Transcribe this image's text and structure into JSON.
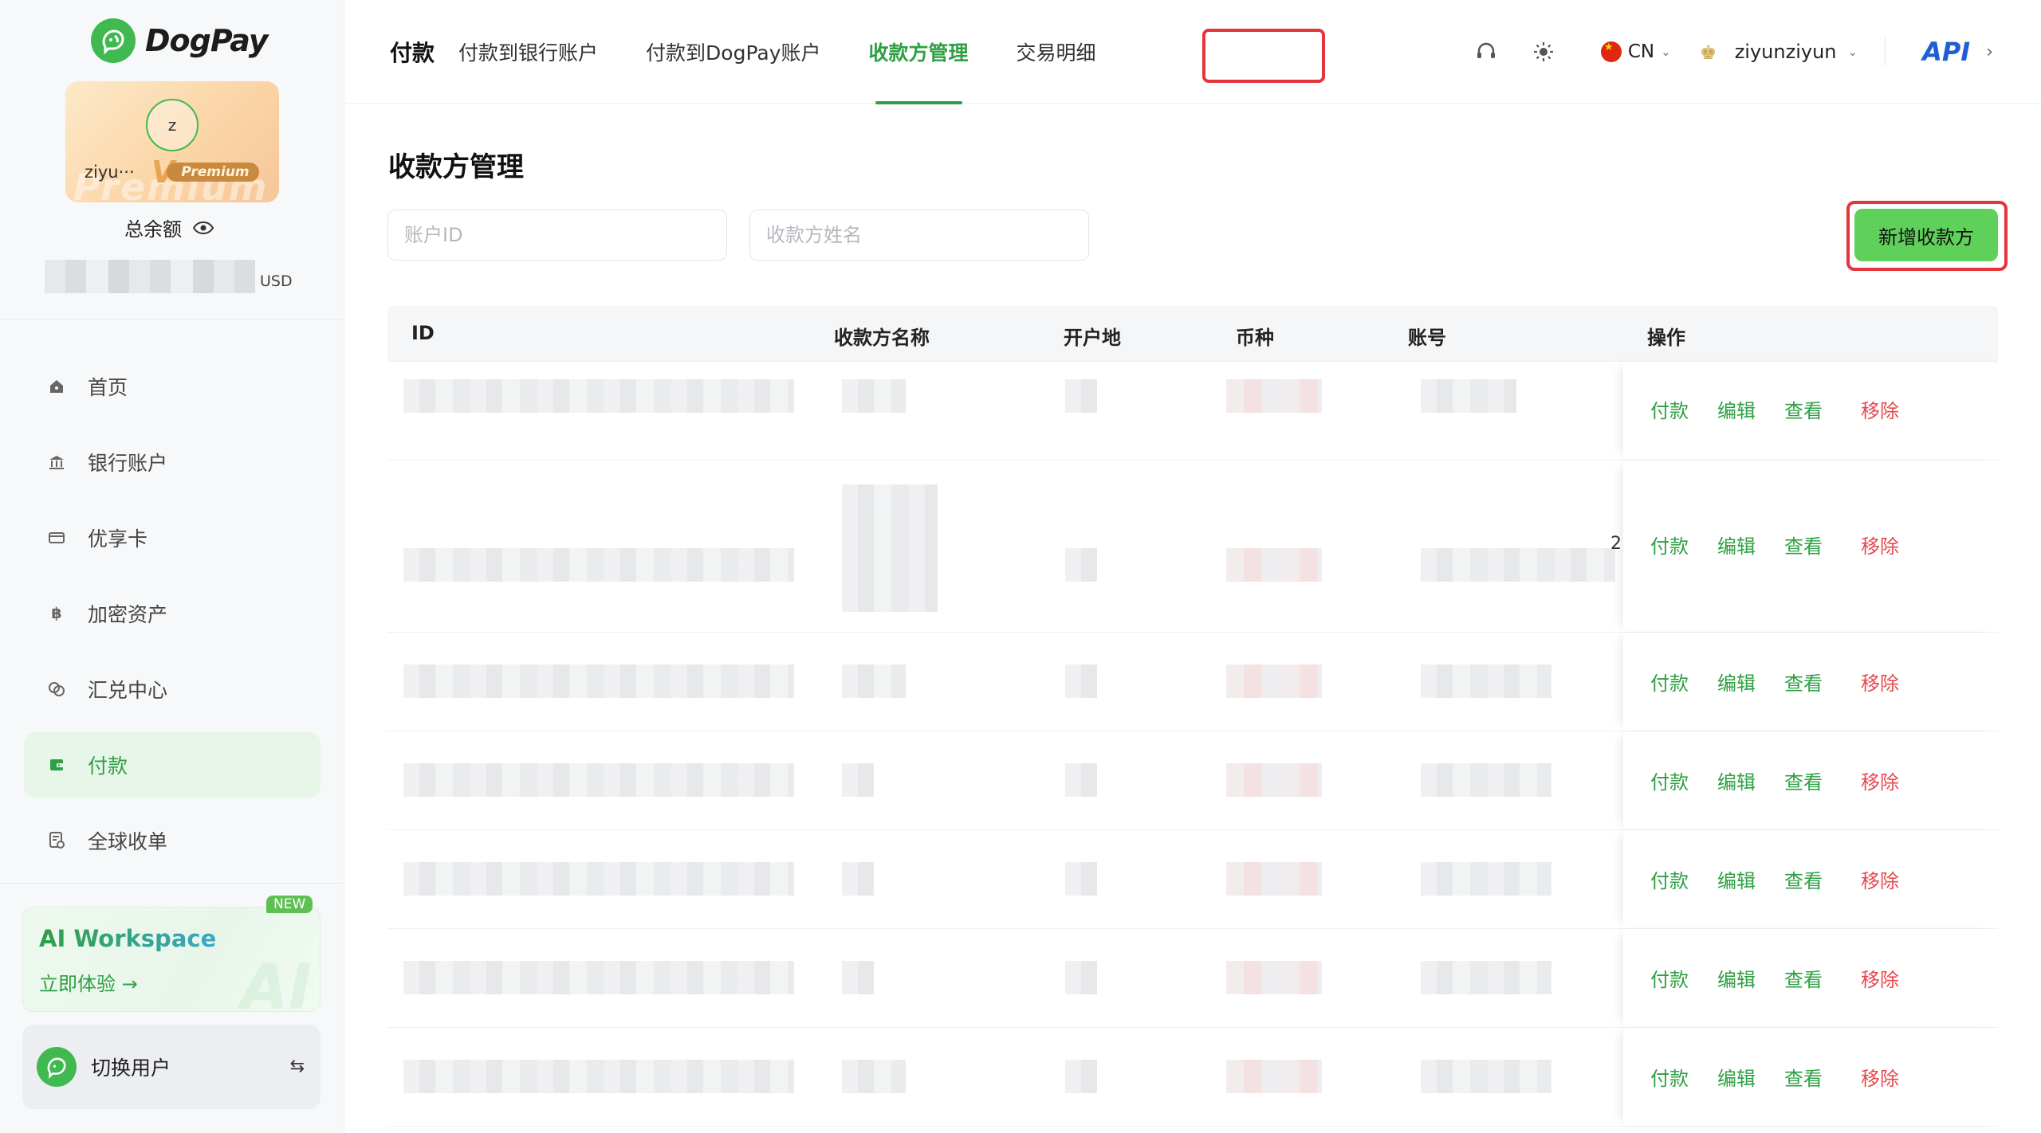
{
  "brand": {
    "name": "DogPay"
  },
  "user_card": {
    "avatar_initial": "z",
    "username": "ziyu···",
    "premium_label": "Premium",
    "premium_mark": "V"
  },
  "balance": {
    "title": "总余额",
    "currency": "USD"
  },
  "sidebar": {
    "items": [
      {
        "label": "首页",
        "icon": "home-icon"
      },
      {
        "label": "银行账户",
        "icon": "bank-icon"
      },
      {
        "label": "优享卡",
        "icon": "card-icon"
      },
      {
        "label": "加密资产",
        "icon": "bitcoin-icon"
      },
      {
        "label": "汇兑中心",
        "icon": "exchange-icon"
      },
      {
        "label": "付款",
        "icon": "wallet-icon",
        "active": true
      },
      {
        "label": "全球收单",
        "icon": "receipt-icon"
      }
    ],
    "ai_workspace": {
      "title": "AI Workspace",
      "cta": "立即体验 →",
      "badge": "NEW",
      "bg_text": "AI"
    },
    "switch_user": {
      "label": "切换用户"
    }
  },
  "topbar": {
    "section_title": "付款",
    "tabs": [
      {
        "label": "付款到银行账户"
      },
      {
        "label": "付款到DogPay账户"
      },
      {
        "label": "收款方管理",
        "active": true
      },
      {
        "label": "交易明细"
      }
    ],
    "language": "CN",
    "username": "ziyunziyun",
    "api_label": "API"
  },
  "main": {
    "title": "收款方管理",
    "filters": {
      "account_id_placeholder": "账户ID",
      "payee_name_placeholder": "收款方姓名"
    },
    "add_button": "新增收款方",
    "table": {
      "columns": [
        "ID",
        "收款方名称",
        "开户地",
        "币种",
        "账号",
        "操作"
      ],
      "row_actions": [
        "付款",
        "编辑",
        "查看",
        "移除"
      ],
      "overflow_text": "2·"
    }
  },
  "colors": {
    "accent": "#2ea043",
    "button_green": "#5fd15a",
    "danger": "#e5484d",
    "highlight_red": "#e5353c"
  }
}
